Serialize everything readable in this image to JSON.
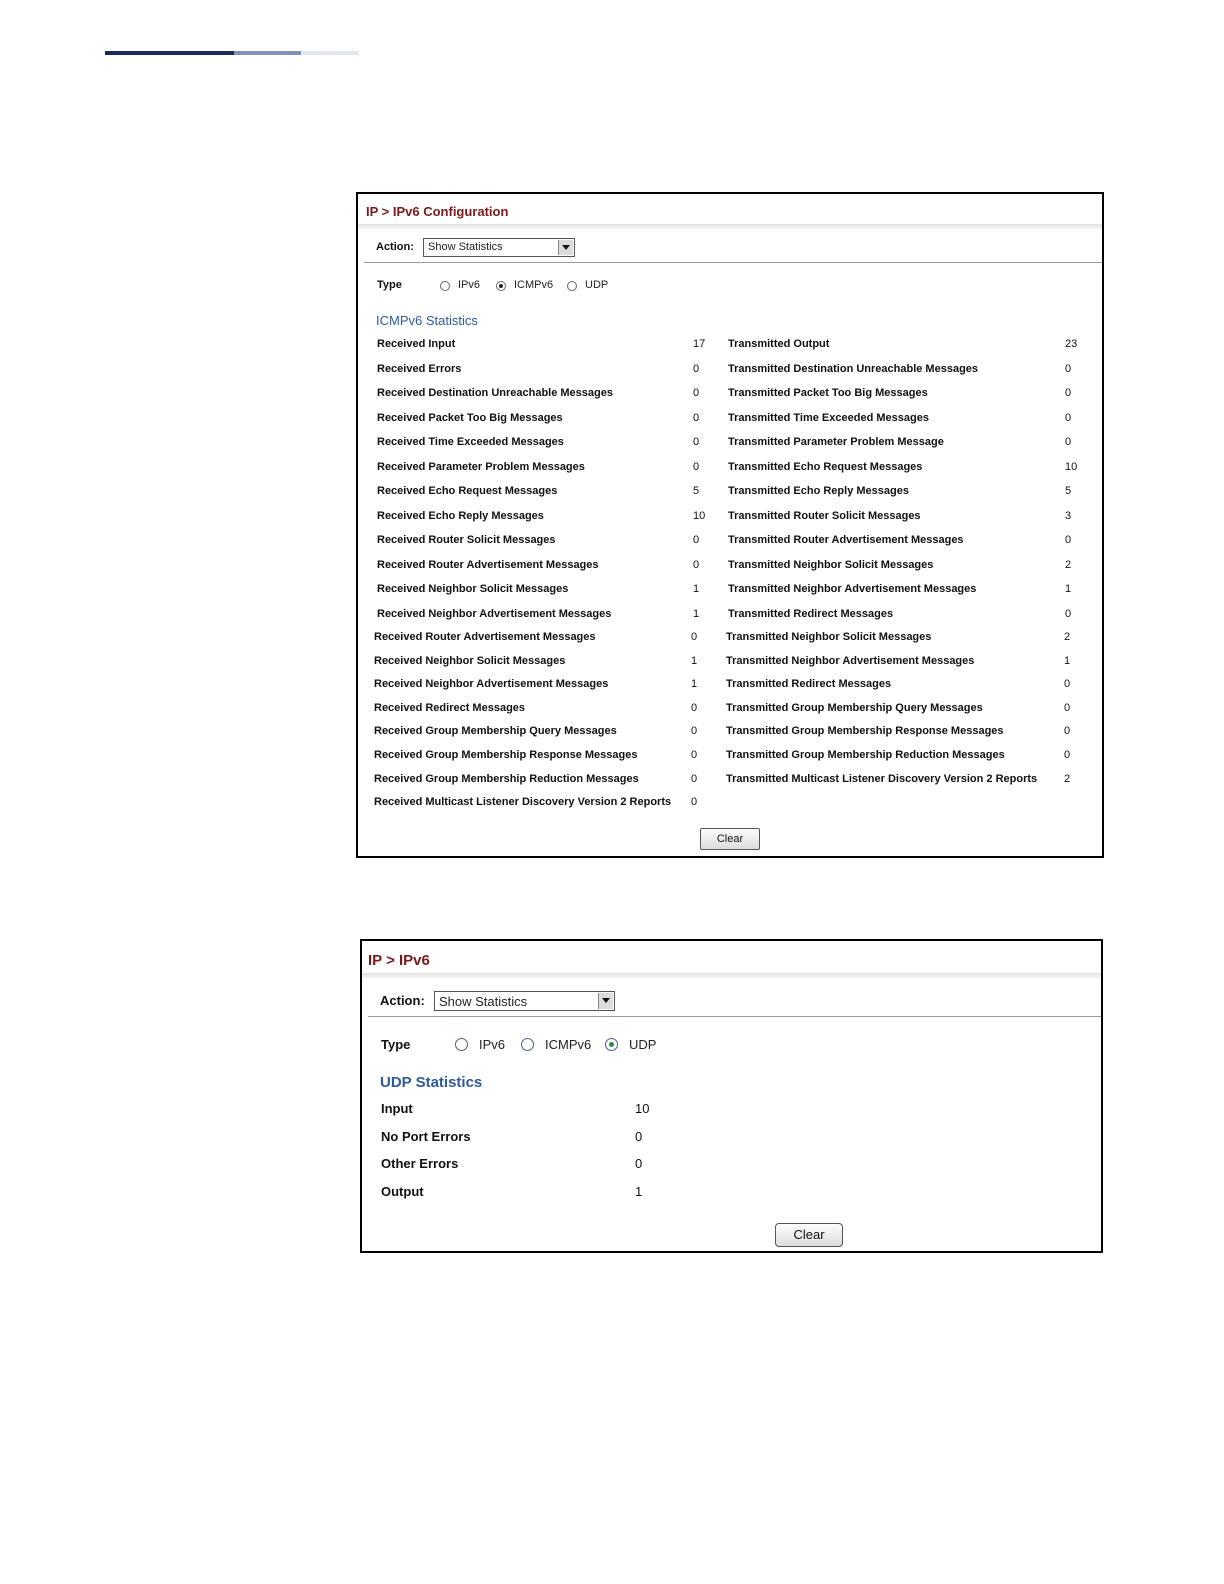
{
  "panel1": {
    "title": "IP > IPv6 Configuration",
    "action_label": "Action:",
    "action_value": "Show Statistics",
    "type_label": "Type",
    "radios": [
      {
        "label": "IPv6",
        "selected": false
      },
      {
        "label": "ICMPv6",
        "selected": true
      },
      {
        "label": "UDP",
        "selected": false
      }
    ],
    "section_title": "ICMPv6 Statistics",
    "left_rows": [
      {
        "label": "Received Input",
        "value": "17"
      },
      {
        "label": "Received Errors",
        "value": "0"
      },
      {
        "label": "Received Destination Unreachable Messages",
        "value": "0"
      },
      {
        "label": "Received Packet Too Big Messages",
        "value": "0"
      },
      {
        "label": "Received Time Exceeded Messages",
        "value": "0"
      },
      {
        "label": "Received Parameter Problem Messages",
        "value": "0"
      },
      {
        "label": "Received Echo Request Messages",
        "value": "5"
      },
      {
        "label": "Received Echo Reply Messages",
        "value": "10"
      },
      {
        "label": "Received Router Solicit Messages",
        "value": "0"
      },
      {
        "label": "Received Router Advertisement Messages",
        "value": "0"
      },
      {
        "label": "Received Neighbor Solicit Messages",
        "value": "1"
      },
      {
        "label": "Received Neighbor Advertisement Messages",
        "value": "1"
      }
    ],
    "right_rows": [
      {
        "label": "Transmitted Output",
        "value": "23"
      },
      {
        "label": "Transmitted Destination Unreachable Messages",
        "value": "0"
      },
      {
        "label": "Transmitted Packet Too Big Messages",
        "value": "0"
      },
      {
        "label": "Transmitted Time Exceeded Messages",
        "value": "0"
      },
      {
        "label": "Transmitted Parameter Problem Message",
        "value": "0"
      },
      {
        "label": "Transmitted Echo Request Messages",
        "value": "10"
      },
      {
        "label": "Transmitted Echo Reply Messages",
        "value": "5"
      },
      {
        "label": "Transmitted Router Solicit Messages",
        "value": "3"
      },
      {
        "label": "Transmitted Router Advertisement Messages",
        "value": "0"
      },
      {
        "label": "Transmitted Neighbor Solicit Messages",
        "value": "2"
      },
      {
        "label": "Transmitted Neighbor Advertisement Messages",
        "value": "1"
      },
      {
        "label": "Transmitted Redirect Messages",
        "value": "0"
      }
    ],
    "left_rows2": [
      {
        "label": "Received Router Advertisement Messages",
        "value": "0"
      },
      {
        "label": "Received Neighbor Solicit Messages",
        "value": "1"
      },
      {
        "label": "Received Neighbor Advertisement Messages",
        "value": "1"
      },
      {
        "label": "Received Redirect Messages",
        "value": "0"
      },
      {
        "label": "Received Group Membership Query Messages",
        "value": "0"
      },
      {
        "label": "Received Group Membership Response Messages",
        "value": "0"
      },
      {
        "label": "Received Group Membership Reduction Messages",
        "value": "0"
      },
      {
        "label": "Received Multicast Listener Discovery Version 2 Reports",
        "value": "0"
      }
    ],
    "right_rows2": [
      {
        "label": "Transmitted Neighbor Solicit Messages",
        "value": "2"
      },
      {
        "label": "Transmitted Neighbor Advertisement Messages",
        "value": "1"
      },
      {
        "label": "Transmitted Redirect Messages",
        "value": "0"
      },
      {
        "label": "Transmitted Group Membership Query Messages",
        "value": "0"
      },
      {
        "label": "Transmitted Group Membership Response Messages",
        "value": "0"
      },
      {
        "label": "Transmitted Group Membership Reduction Messages",
        "value": "0"
      },
      {
        "label": "Transmitted Multicast Listener Discovery Version 2 Reports",
        "value": "2"
      }
    ],
    "clear_label": "Clear"
  },
  "panel2": {
    "title": "IP > IPv6",
    "action_label": "Action:",
    "action_value": "Show Statistics",
    "type_label": "Type",
    "radios": [
      {
        "label": "IPv6",
        "selected": false
      },
      {
        "label": "ICMPv6",
        "selected": false
      },
      {
        "label": "UDP",
        "selected": true
      }
    ],
    "section_title": "UDP Statistics",
    "rows": [
      {
        "label": "Input",
        "value": "10"
      },
      {
        "label": "No Port Errors",
        "value": "0"
      },
      {
        "label": "Other Errors",
        "value": "0"
      },
      {
        "label": "Output",
        "value": "1"
      }
    ],
    "clear_label": "Clear"
  },
  "colors": {
    "title": "#7a1a1a",
    "section_title": "#2f5a9a",
    "header_bar_dark": "#1c2a5a",
    "header_bar_mid": "#7f91b6",
    "header_bar_light": "#e2e6ee"
  }
}
